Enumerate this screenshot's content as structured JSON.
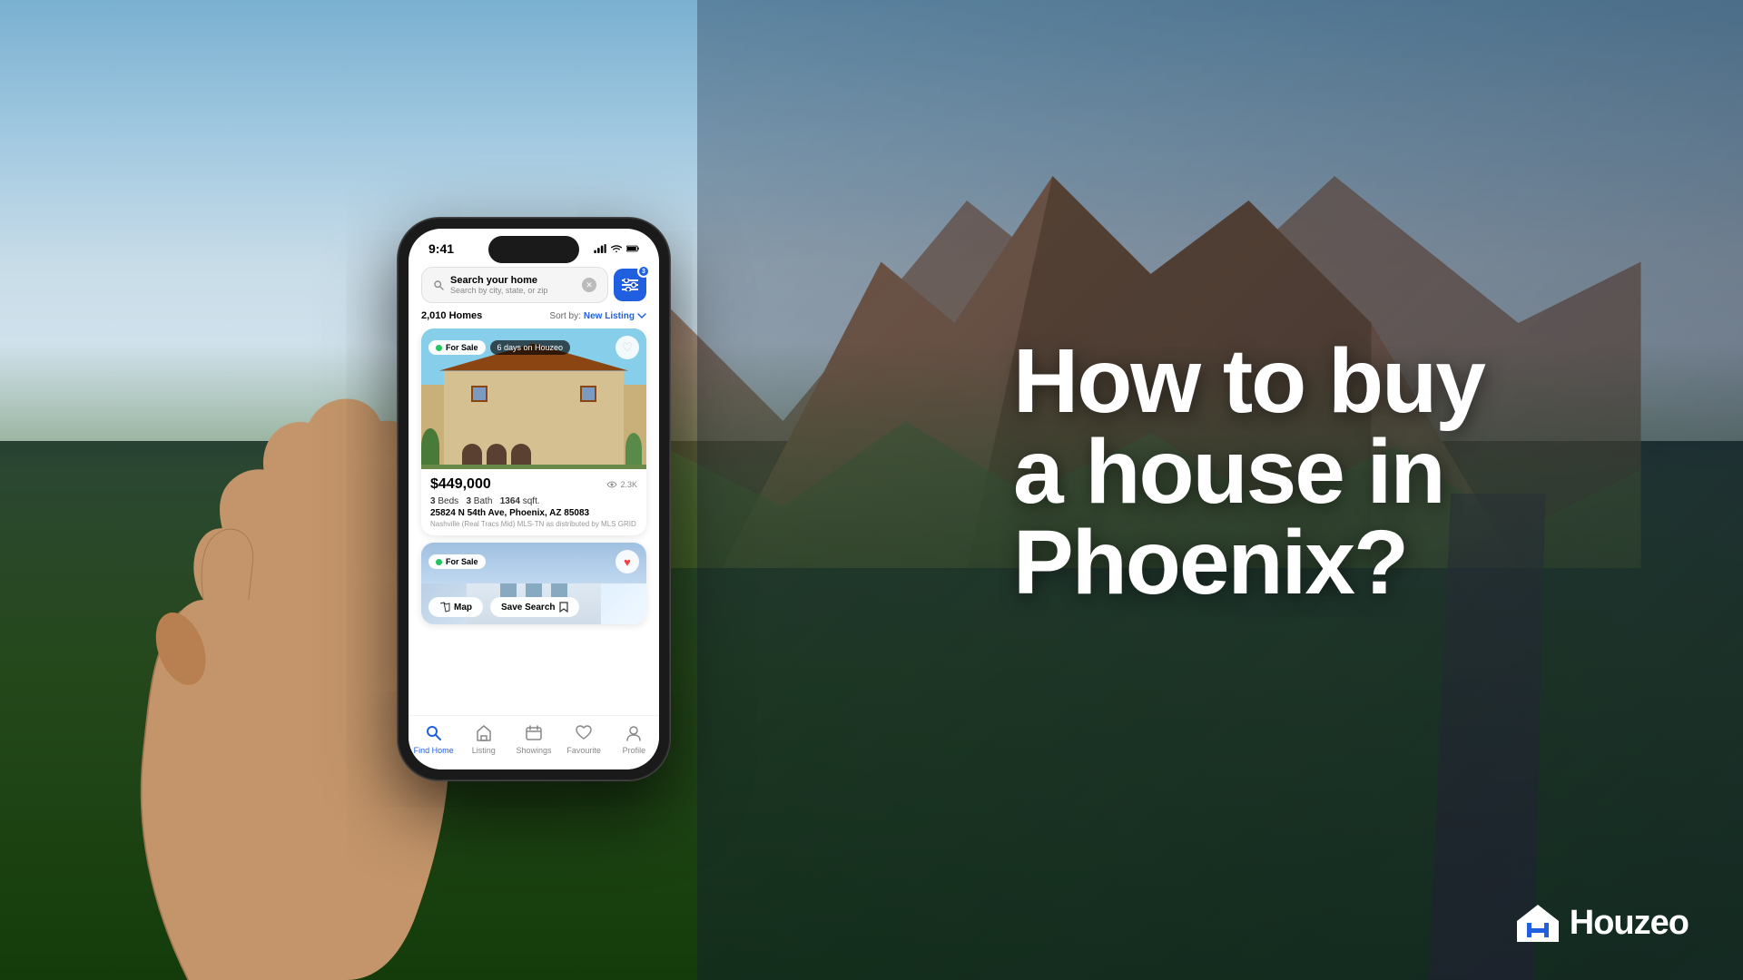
{
  "background": {
    "alt": "Aerial view of Phoenix Arizona neighborhood with mountains"
  },
  "headline": {
    "line1": "How to buy",
    "line2": "a house in",
    "line3": "Phoenix?"
  },
  "phone": {
    "status_time": "9:41",
    "search": {
      "title": "Search your home",
      "placeholder": "Search by city, state, or zip",
      "filter_count": "3"
    },
    "homes_count": "2,010 Homes",
    "sort_label": "Sort by:",
    "sort_value": "New Listing",
    "listings": [
      {
        "status": "For Sale",
        "days_on": "6 days on Houzeo",
        "price": "$449,000",
        "views": "2.3K",
        "beds": "3",
        "baths": "3",
        "sqft": "1364",
        "address": "25824 N 54th Ave, Phoenix, AZ 85083",
        "source": "Nashville (Real Tracs Mid) MLS-TN as distributed by MLS GRID"
      },
      {
        "status": "For Sale",
        "price": "",
        "map_label": "Map",
        "save_search_label": "Save Search"
      }
    ],
    "bottom_nav": [
      {
        "label": "Find Home",
        "active": true,
        "icon": "search-icon"
      },
      {
        "label": "Listing",
        "active": false,
        "icon": "listing-icon"
      },
      {
        "label": "Showings",
        "active": false,
        "icon": "showings-icon"
      },
      {
        "label": "Favourite",
        "active": false,
        "icon": "favourite-icon"
      },
      {
        "label": "Profile",
        "active": false,
        "icon": "profile-icon"
      }
    ]
  },
  "logo": {
    "name": "Houzeo",
    "icon": "house-icon"
  }
}
